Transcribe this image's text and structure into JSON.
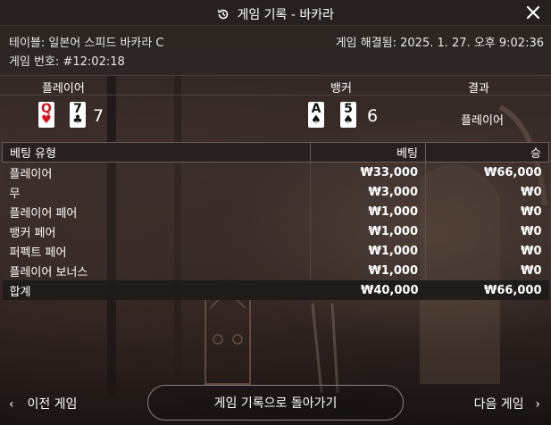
{
  "header": {
    "title": "게임 기록 - 바카라"
  },
  "info": {
    "table_label": "테이블: 일본어 스피드 바카라 C",
    "resolved_label": "게임 해결됨: 2025. 1. 27. 오후 9:02:36",
    "game_number": "게임 번호: #12:02:18"
  },
  "result": {
    "player_header": "플레이어",
    "banker_header": "뱅커",
    "result_header": "결과",
    "player_cards": [
      {
        "rank": "Q",
        "suit": "♥",
        "color": "#d7141c"
      },
      {
        "rank": "7",
        "suit": "♣",
        "color": "#111111"
      }
    ],
    "player_score": "7",
    "banker_cards": [
      {
        "rank": "A",
        "suit": "♠",
        "color": "#111111"
      },
      {
        "rank": "5",
        "suit": "♠",
        "color": "#111111"
      }
    ],
    "banker_score": "6",
    "result_value": "플레이어"
  },
  "bets": {
    "headers": {
      "type": "베팅 유형",
      "bet": "베팅",
      "win": "승"
    },
    "rows": [
      {
        "type": "플레이어",
        "bet": "₩33,000",
        "win": "₩66,000"
      },
      {
        "type": "무",
        "bet": "₩3,000",
        "win": "₩0"
      },
      {
        "type": "플레이어 페어",
        "bet": "₩1,000",
        "win": "₩0"
      },
      {
        "type": "뱅커 페어",
        "bet": "₩1,000",
        "win": "₩0"
      },
      {
        "type": "퍼펙트 페어",
        "bet": "₩1,000",
        "win": "₩0"
      },
      {
        "type": "플레이어 보너스",
        "bet": "₩1,000",
        "win": "₩0"
      }
    ],
    "total": {
      "type": "합계",
      "bet": "₩40,000",
      "win": "₩66,000"
    }
  },
  "footer": {
    "prev_label": "이전 게임",
    "back_label": "게임 기록으로 돌아가기",
    "next_label": "다음 게임"
  }
}
